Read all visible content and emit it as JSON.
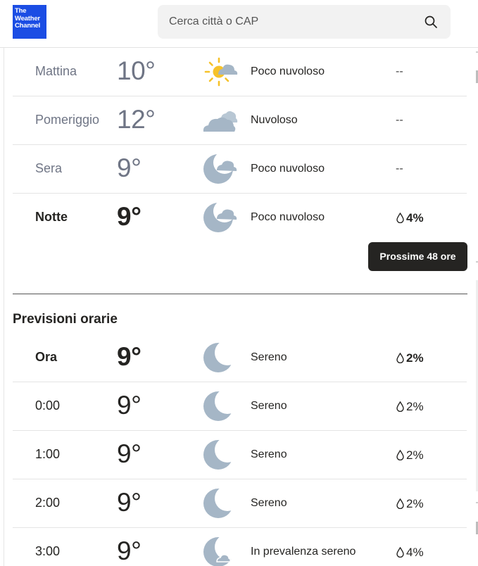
{
  "header": {
    "logo_lines": [
      "The",
      "Weather",
      "Channel"
    ],
    "search_placeholder": "Cerca città o CAP"
  },
  "daypart": [
    {
      "label": "Mattina",
      "temp": "10°",
      "icon": "partly-cloudy-day-icon",
      "condition": "Poco nuvoloso",
      "precip": "--"
    },
    {
      "label": "Pomeriggio",
      "temp": "12°",
      "icon": "cloudy-icon",
      "condition": "Nuvoloso",
      "precip": "--"
    },
    {
      "label": "Sera",
      "temp": "9°",
      "icon": "partly-cloudy-night-icon",
      "condition": "Poco nuvoloso",
      "precip": "--"
    },
    {
      "label": "Notte",
      "temp": "9°",
      "icon": "partly-cloudy-night-icon",
      "condition": "Poco nuvoloso",
      "precip": "4%"
    }
  ],
  "tooltip": "Prossime 48 ore",
  "hourly": {
    "title": "Previsioni orarie",
    "rows": [
      {
        "label": "Ora",
        "temp": "9°",
        "icon": "clear-night-icon",
        "condition": "Sereno",
        "precip": "2%"
      },
      {
        "label": "0:00",
        "temp": "9°",
        "icon": "clear-night-icon",
        "condition": "Sereno",
        "precip": "2%"
      },
      {
        "label": "1:00",
        "temp": "9°",
        "icon": "clear-night-icon",
        "condition": "Sereno",
        "precip": "2%"
      },
      {
        "label": "2:00",
        "temp": "9°",
        "icon": "clear-night-icon",
        "condition": "Sereno",
        "precip": "2%"
      },
      {
        "label": "3:00",
        "temp": "9°",
        "icon": "mostly-clear-night-icon",
        "condition": "In prevalenza sereno",
        "precip": "4%"
      }
    ]
  },
  "colors": {
    "logo_blue": "#1b4de4",
    "icon_grey": "#a5b6c6",
    "sun_yellow": "#f6c22a",
    "text_dark": "#252422",
    "text_muted": "#6f7585",
    "tooltip_bg": "#252422"
  }
}
